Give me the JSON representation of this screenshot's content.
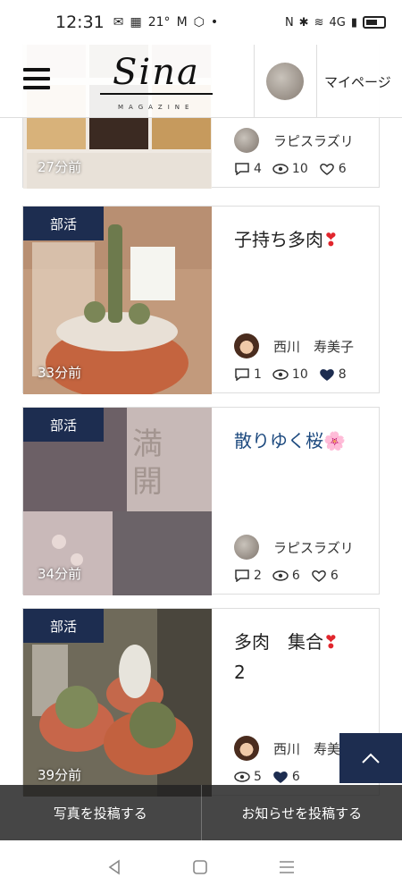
{
  "status_bar": {
    "time": "12:31",
    "temperature": "21°",
    "network": "4G"
  },
  "header": {
    "logo_text": "Sina",
    "logo_sub": "MAGAZINE",
    "mypage_label": "マイページ"
  },
  "top_card": {
    "time": "27分前",
    "author": "ラピスラズリ",
    "comments": "4",
    "views": "10",
    "likes": "6"
  },
  "cards": [
    {
      "category": "部活",
      "time": "33分前",
      "title": "子持ち多肉",
      "title_emoji": "❣",
      "author": "西川　寿美子",
      "comments": "1",
      "views": "10",
      "likes": "8",
      "liked": true
    },
    {
      "category": "部活",
      "time": "34分前",
      "title": "散りゆく桜",
      "title_emoji": "🌸",
      "author": "ラピスラズリ",
      "comments": "2",
      "views": "6",
      "likes": "6",
      "liked": false
    },
    {
      "category": "部活",
      "time": "39分前",
      "title": "多肉　集合",
      "title_emoji": "❣",
      "title_line2": "2",
      "author": "西川　寿美",
      "views": "5",
      "likes": "6",
      "liked": true
    }
  ],
  "actions": {
    "post_photo": "写真を投稿する",
    "post_news": "お知らせを投稿する"
  },
  "colors": {
    "accent": "#1d2d50",
    "heart": "#e1262d"
  }
}
